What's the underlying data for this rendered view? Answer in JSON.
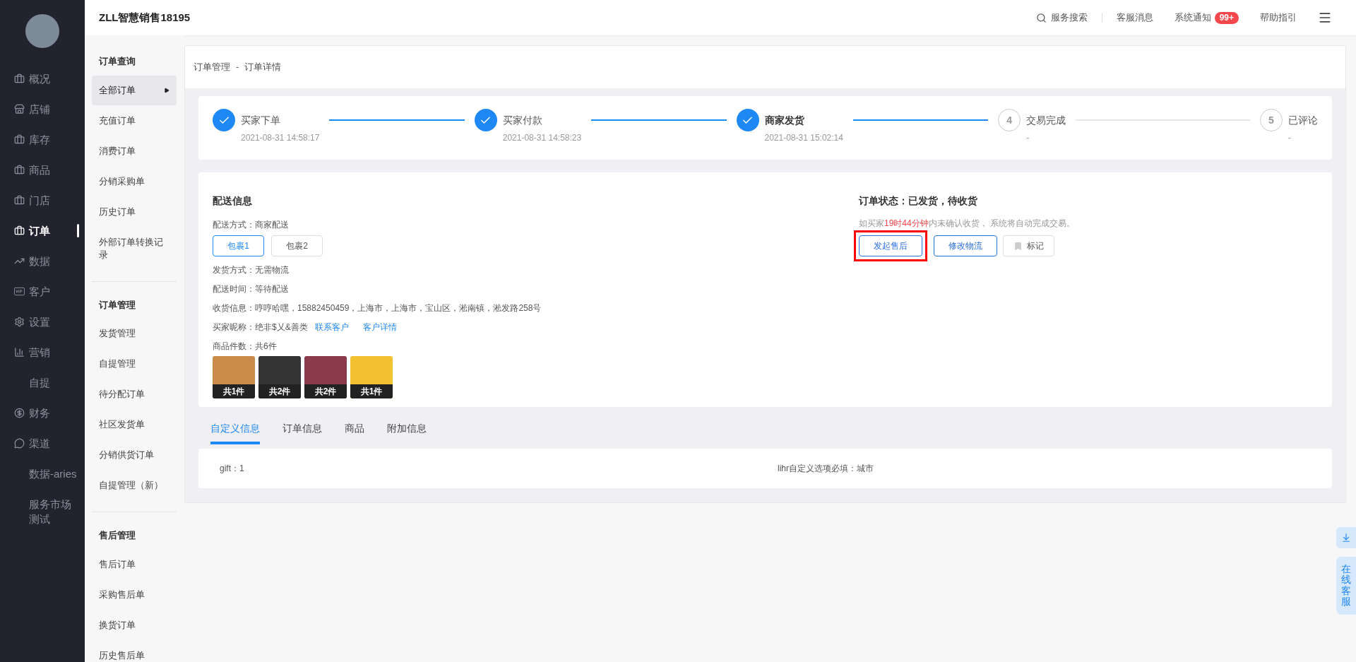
{
  "header": {
    "title": "ZLL智慧销售18195",
    "search": "服务搜索",
    "messages": "客服消息",
    "notifications": "系统通知",
    "badge": "99+",
    "help": "帮助指引"
  },
  "sidebar": {
    "items": [
      {
        "label": "概况",
        "selected": false
      },
      {
        "label": "店铺",
        "selected": false
      },
      {
        "label": "库存",
        "selected": false
      },
      {
        "label": "商品",
        "selected": false
      },
      {
        "label": "门店",
        "selected": false
      },
      {
        "label": "订单",
        "selected": true
      },
      {
        "label": "数据",
        "selected": false
      },
      {
        "label": "客户",
        "selected": false
      },
      {
        "label": "设置",
        "selected": false
      },
      {
        "label": "营销",
        "selected": false
      },
      {
        "label": "自提",
        "selected": false
      },
      {
        "label": "财务",
        "selected": false
      },
      {
        "label": "渠道",
        "selected": false
      },
      {
        "label": "数据-aries",
        "selected": false
      },
      {
        "label": "服务市场测试",
        "selected": false
      }
    ]
  },
  "submenu": [
    {
      "title": "订单查询",
      "items": [
        {
          "label": "全部订单",
          "selected": true
        },
        {
          "label": "充值订单",
          "selected": false
        },
        {
          "label": "消费订单",
          "selected": false
        },
        {
          "label": "分销采购单",
          "selected": false
        },
        {
          "label": "历史订单",
          "selected": false
        },
        {
          "label": "外部订单转换记录",
          "selected": false
        }
      ]
    },
    {
      "title": "订单管理",
      "items": [
        {
          "label": "发货管理",
          "selected": false
        },
        {
          "label": "自提管理",
          "selected": false
        },
        {
          "label": "待分配订单",
          "selected": false
        },
        {
          "label": "社区发货单",
          "selected": false
        },
        {
          "label": "分销供货订单",
          "selected": false
        },
        {
          "label": "自提管理（新）",
          "selected": false
        }
      ]
    },
    {
      "title": "售后管理",
      "items": [
        {
          "label": "售后订单",
          "selected": false
        },
        {
          "label": "采购售后单",
          "selected": false
        },
        {
          "label": "换货订单",
          "selected": false
        },
        {
          "label": "历史售后单",
          "selected": false
        }
      ]
    }
  ],
  "breadcrumb": [
    "订单管理",
    "-",
    "订单详情"
  ],
  "steps": [
    {
      "label": "买家下单",
      "time": "2021-08-31 14:58:17",
      "done": true
    },
    {
      "label": "买家付款",
      "time": "2021-08-31 14:58:23",
      "done": true
    },
    {
      "label": "商家发货",
      "time": "2021-08-31 15:02:14",
      "done": true
    },
    {
      "number": "4",
      "label": "交易完成",
      "time": "-",
      "done": false
    },
    {
      "number": "5",
      "label": "已评论",
      "time": "-",
      "done": false
    }
  ],
  "delivery": {
    "title": "配送信息",
    "method": "配送方式：商家配送",
    "packages": [
      {
        "label": "包裹1",
        "selected": true
      },
      {
        "label": "包裹2",
        "selected": false
      }
    ],
    "rows": [
      "发货方式：无需物流",
      "配送时间：等待配送",
      "收货信息：哼哼哈嘿，15882450459，上海市，上海市，宝山区，淞南镇，淞发路258号"
    ],
    "buyer": "买家昵称：绝非$乂&善类",
    "links": [
      "联系客户",
      "客户详情"
    ],
    "count": "商品件数：共6件",
    "products": [
      {
        "badge": "共1件"
      },
      {
        "badge": "共2件"
      },
      {
        "badge": "共2件"
      },
      {
        "badge": "共1件"
      }
    ]
  },
  "status": {
    "title": "订单状态：已发货，待收货",
    "note_before": "如买家",
    "note_time": "19时44分钟",
    "note_after": "内未确认收货， 系统将自动完成交易。",
    "buttons": [
      {
        "label": "发起售后",
        "kind": "outline",
        "highlighted": true
      },
      {
        "label": "修改物流",
        "kind": "outline",
        "highlighted": false
      },
      {
        "label": "标记",
        "kind": "mark",
        "highlighted": false
      }
    ]
  },
  "tabs": [
    {
      "label": "自定义信息",
      "selected": true
    },
    {
      "label": "订单信息",
      "selected": false
    },
    {
      "label": "商品",
      "selected": false
    },
    {
      "label": "附加信息",
      "selected": false
    }
  ],
  "custom": [
    "gift：1",
    "lihr自定义选项必填：城市"
  ],
  "float": {
    "service": "在线客服"
  }
}
